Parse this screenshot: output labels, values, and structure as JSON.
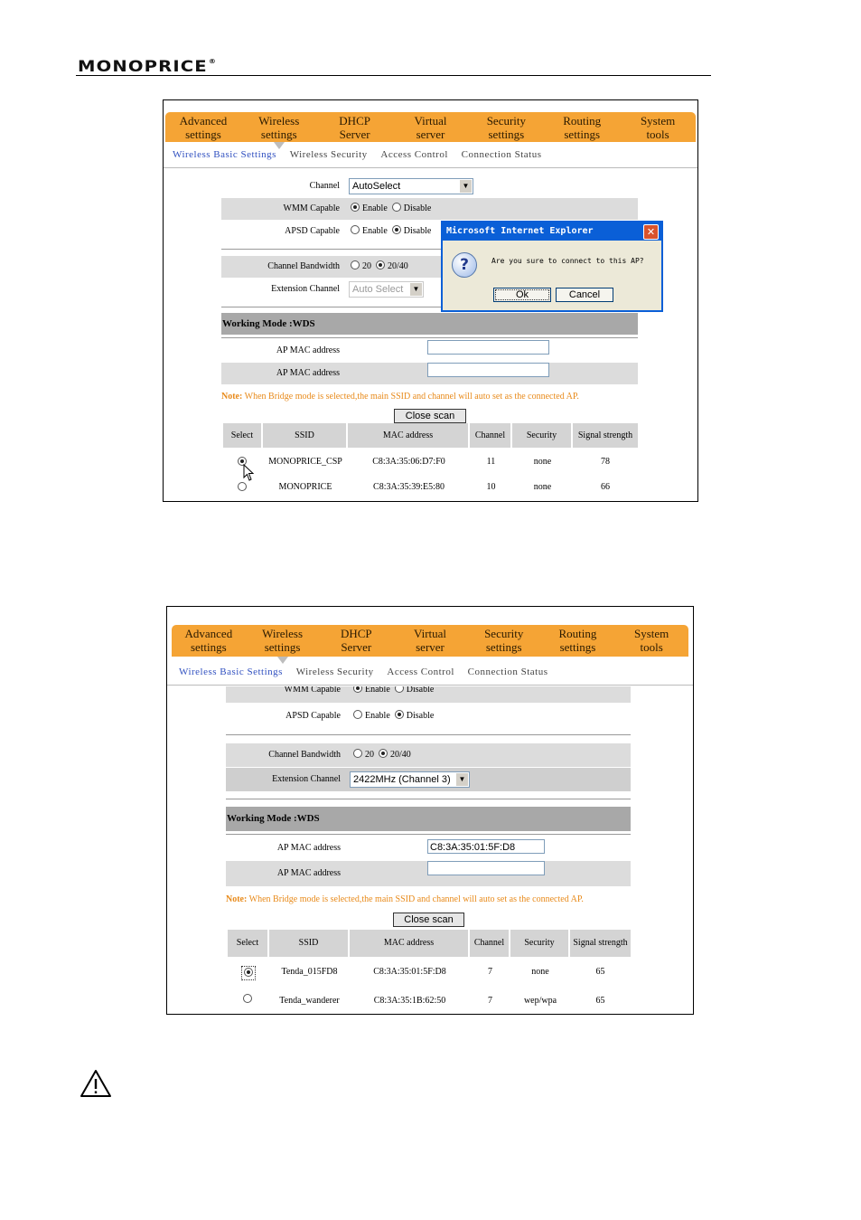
{
  "brand": {
    "logo_text": "MONOPRICE",
    "registered": "®"
  },
  "nav": [
    {
      "line1": "Advanced",
      "line2": "settings"
    },
    {
      "line1": "Wireless",
      "line2": "settings"
    },
    {
      "line1": "DHCP",
      "line2": "Server"
    },
    {
      "line1": "Virtual",
      "line2": "server"
    },
    {
      "line1": "Security",
      "line2": "settings"
    },
    {
      "line1": "Routing",
      "line2": "settings"
    },
    {
      "line1": "System",
      "line2": "tools"
    }
  ],
  "subnav": [
    "Wireless Basic Settings",
    "Wireless Security",
    "Access Control",
    "Connection Status"
  ],
  "labels": {
    "channel": "Channel",
    "wmm": "WMM Capable",
    "apsd": "APSD Capable",
    "bandwidth": "Channel Bandwidth",
    "extension": "Extension Channel",
    "ap_mac": "AP MAC address",
    "enable": "Enable",
    "disable": "Disable",
    "bw20": "20",
    "bw2040": "20/40"
  },
  "section_title": "Working Mode :WDS",
  "note_prefix": "Note:",
  "note_text": " When Bridge mode is selected,the main SSID and channel will auto set as the connected AP.",
  "close_scan": "Close scan",
  "table_headers": [
    "Select",
    "SSID",
    "MAC address",
    "Channel",
    "Security",
    "Signal strength"
  ],
  "screen1": {
    "channel_value": "AutoSelect",
    "extension_value": "Auto Select",
    "ap_mac_1": "",
    "ap_mac_2": "",
    "rows": [
      {
        "ssid": "MONOPRICE_CSP",
        "mac": "C8:3A:35:06:D7:F0",
        "channel": "11",
        "security": "none",
        "signal": "78"
      },
      {
        "ssid": "MONOPRICE",
        "mac": "C8:3A:35:39:E5:80",
        "channel": "10",
        "security": "none",
        "signal": "66"
      }
    ],
    "dialog": {
      "title": "Microsoft Internet Explorer",
      "message": "Are you sure to connect to this AP?",
      "ok": "Ok",
      "cancel": "Cancel",
      "close": "✕",
      "icon": "?"
    }
  },
  "screen2": {
    "extension_value": "2422MHz (Channel 3)",
    "ap_mac_1": "C8:3A:35:01:5F:D8",
    "ap_mac_2": "",
    "rows": [
      {
        "ssid": "Tenda_015FD8",
        "mac": "C8:3A:35:01:5F:D8",
        "channel": "7",
        "security": "none",
        "signal": "65"
      },
      {
        "ssid": "Tenda_wanderer",
        "mac": "C8:3A:35:1B:62:50",
        "channel": "7",
        "security": "wep/wpa",
        "signal": "65"
      }
    ]
  },
  "icons": {
    "warning": "warning-icon",
    "dropdown": "▼"
  }
}
